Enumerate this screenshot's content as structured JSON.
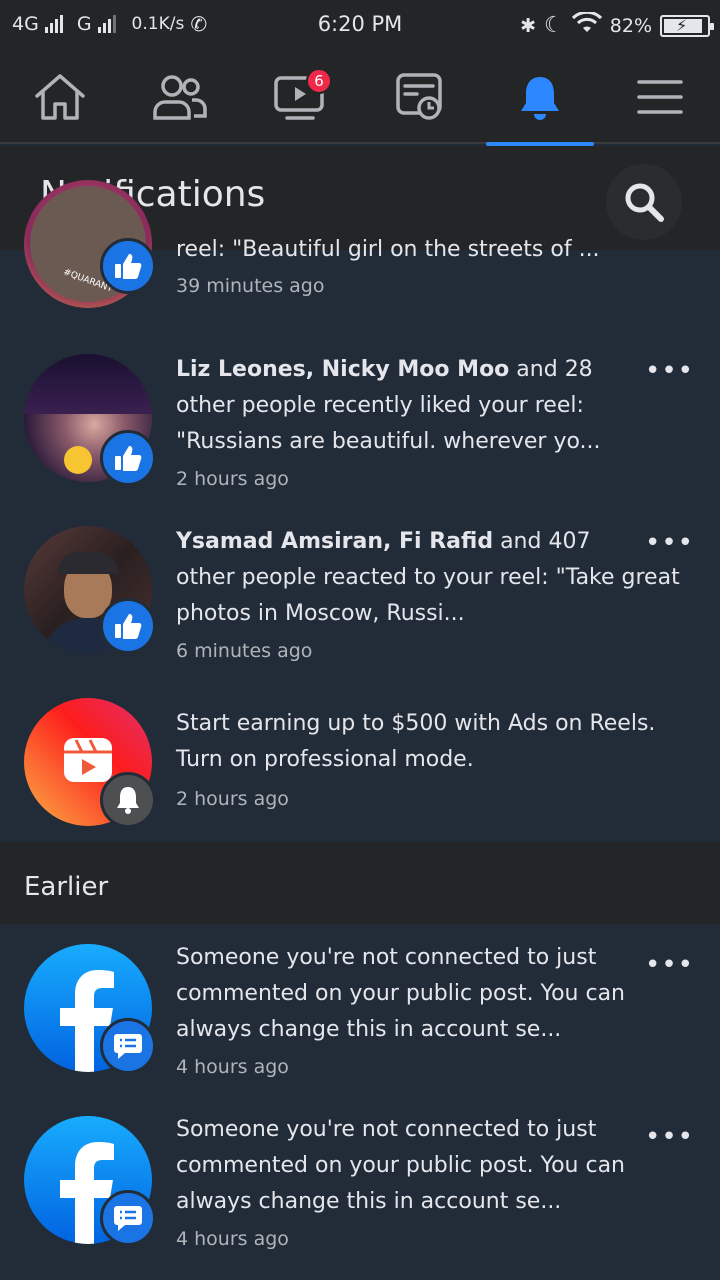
{
  "status_bar": {
    "network_1": "4G",
    "network_2": "G",
    "speed": "0.1K/s",
    "time": "6:20 PM",
    "battery": "82%"
  },
  "nav": {
    "items": [
      {
        "name": "home",
        "icon": "home-icon"
      },
      {
        "name": "friends",
        "icon": "friends-icon"
      },
      {
        "name": "watch",
        "icon": "video-icon",
        "badge": "6"
      },
      {
        "name": "feeds",
        "icon": "news-icon"
      },
      {
        "name": "notifications",
        "icon": "bell-icon",
        "active": true
      },
      {
        "name": "menu",
        "icon": "menu-icon"
      }
    ]
  },
  "header": {
    "title": "Notifications"
  },
  "notifications": [
    {
      "text_plain": "reel: \"Beautiful girl on the streets of ...",
      "time": "39 minutes ago",
      "badge": "like"
    },
    {
      "bold": "Liz Leones, Nicky Moo Moo",
      "text_line1_rest": " and 28",
      "text_rest": "other people recently liked your reel: \"Russians are beautiful. wherever yo...",
      "time": "2 hours ago",
      "badge": "like"
    },
    {
      "bold": "Ysamad Amsiran, Fi Rafid",
      "text_line1_rest": " and 407",
      "text_rest": "other people reacted to your reel: \"Take great photos in Moscow, Russi...",
      "time": "6 minutes ago",
      "badge": "like"
    },
    {
      "text_plain": "Start earning up to $500 with Ads on Reels. Turn on professional mode.",
      "time": "2 hours ago",
      "badge": "bell"
    }
  ],
  "earlier": {
    "title": "Earlier",
    "items": [
      {
        "text_plain": "Someone you're not connected to just commented on your public post. You can always change this in account se...",
        "time": "4 hours ago",
        "badge": "comment"
      },
      {
        "text_plain": "Someone you're not connected to just commented on your public post. You can always change this in account se...",
        "time": "4 hours ago",
        "badge": "comment"
      }
    ]
  },
  "colors": {
    "accent": "#2d88ff",
    "badge_red": "#f02849",
    "background": "#222c38",
    "facebook_blue": "#1b74e4"
  }
}
